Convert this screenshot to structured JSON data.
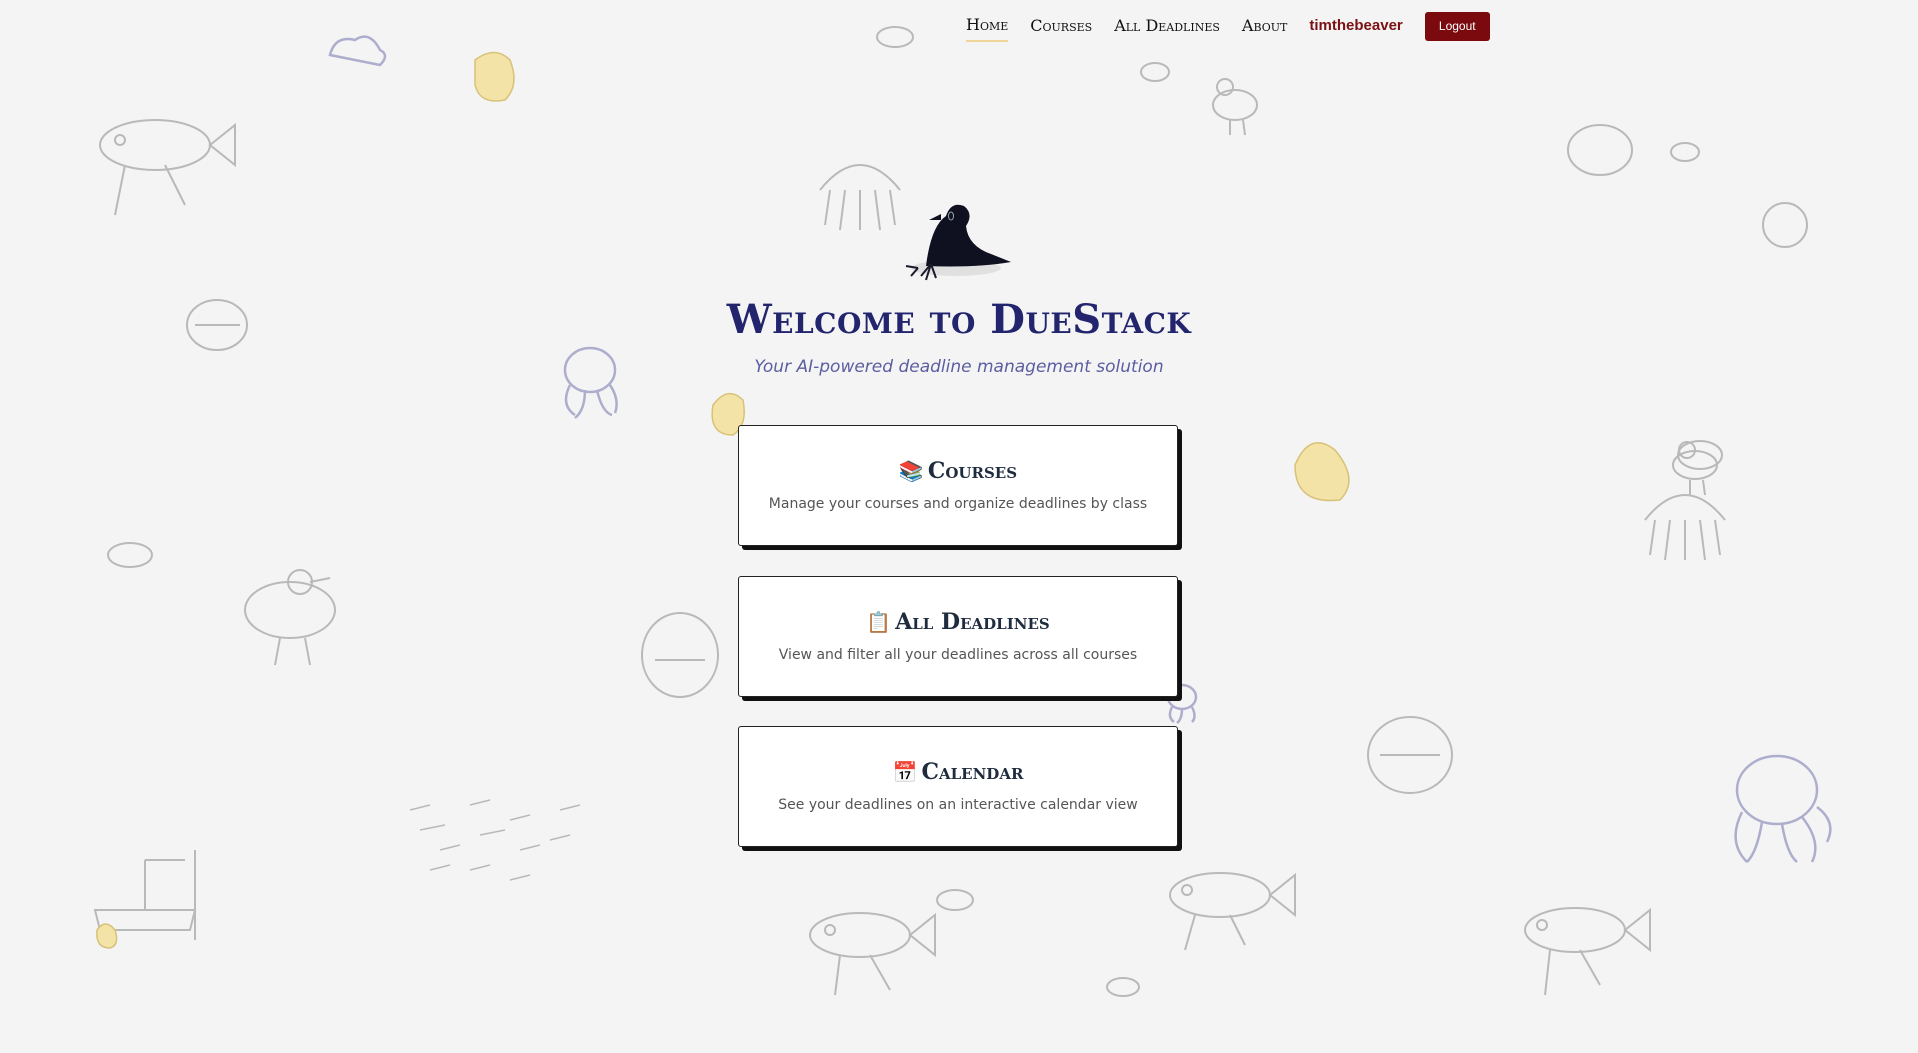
{
  "nav": {
    "links": [
      "Home",
      "Courses",
      "All Deadlines",
      "About"
    ],
    "active": "Home",
    "username": "timthebeaver",
    "logout_label": "Logout"
  },
  "hero": {
    "title": "Welcome to DueStack",
    "subtitle": "Your AI-powered deadline management solution"
  },
  "cards": [
    {
      "icon": "books-icon",
      "emoji": "📚",
      "title": "Courses",
      "description": "Manage your courses and organize deadlines by class"
    },
    {
      "icon": "clipboard-icon",
      "emoji": "📋",
      "title": "All Deadlines",
      "description": "View and filter all your deadlines across all courses"
    },
    {
      "icon": "calendar-icon",
      "emoji": "📅",
      "title": "Calendar",
      "description": "See your deadlines on an interactive calendar view"
    }
  ],
  "colors": {
    "background": "#f4f4f4",
    "title": "#22256e",
    "subtitle": "#5b5ea0",
    "accent": "#7a0a0e",
    "username": "#7a1113",
    "nav_underline": "#f0d59a"
  }
}
